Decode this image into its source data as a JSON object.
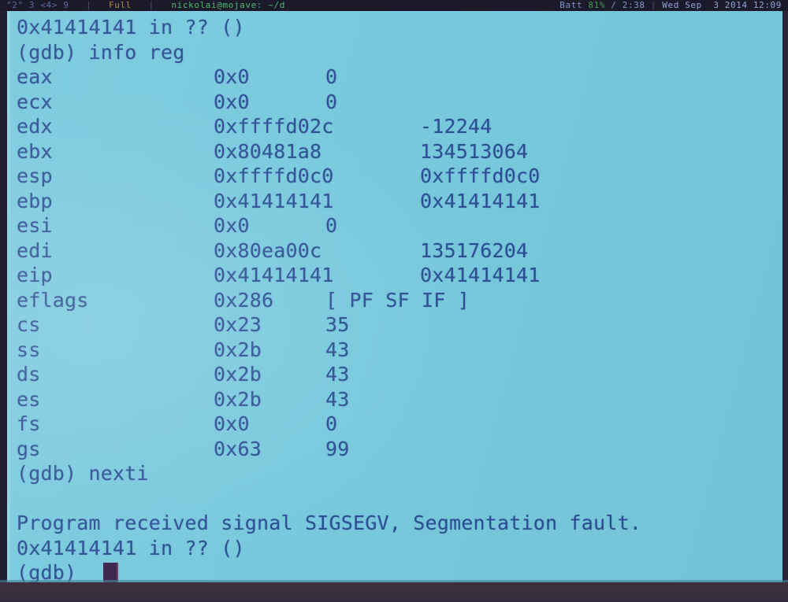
{
  "statusbar": {
    "workspaces": "°2° 3 <4> 9",
    "separator1": "|",
    "layout": "Full",
    "separator2": "|",
    "window_title": "nickolai@mojave: ~/d",
    "battery_label": "Batt",
    "battery_percent": "81%",
    "battery_divider": "/",
    "battery_time": "2:38",
    "separator3": "|",
    "datetime": "Wed Sep  3 2014 12:09"
  },
  "colors": {
    "terminal_bg": "#79c9dc",
    "terminal_fg": "#2e4f93",
    "statusbar_bg": "#1b1a2b",
    "cursor": "#3a2248",
    "frame": "#231f2e"
  },
  "terminal": {
    "prompt": "(gdb)",
    "lines": [
      {
        "type": "text",
        "text": "0x41414141 in ?? ()"
      },
      {
        "type": "text",
        "text": "(gdb) info reg"
      },
      {
        "type": "reg",
        "name": "eax",
        "hex": "0x0",
        "dec": "0",
        "wide": false
      },
      {
        "type": "reg",
        "name": "ecx",
        "hex": "0x0",
        "dec": "0",
        "wide": false
      },
      {
        "type": "reg",
        "name": "edx",
        "hex": "0xffffd02c",
        "dec": "-12244",
        "wide": true
      },
      {
        "type": "reg",
        "name": "ebx",
        "hex": "0x80481a8",
        "dec": "134513064",
        "wide": true
      },
      {
        "type": "reg",
        "name": "esp",
        "hex": "0xffffd0c0",
        "dec": "0xffffd0c0",
        "wide": true
      },
      {
        "type": "reg",
        "name": "ebp",
        "hex": "0x41414141",
        "dec": "0x41414141",
        "wide": true
      },
      {
        "type": "reg",
        "name": "esi",
        "hex": "0x0",
        "dec": "0",
        "wide": false
      },
      {
        "type": "reg",
        "name": "edi",
        "hex": "0x80ea00c",
        "dec": "135176204",
        "wide": true
      },
      {
        "type": "reg",
        "name": "eip",
        "hex": "0x41414141",
        "dec": "0x41414141",
        "wide": true
      },
      {
        "type": "reg",
        "name": "eflags",
        "hex": "0x286",
        "dec": "[ PF SF IF ]",
        "wide": false,
        "flags": true
      },
      {
        "type": "reg",
        "name": "cs",
        "hex": "0x23",
        "dec": "35",
        "wide": false
      },
      {
        "type": "reg",
        "name": "ss",
        "hex": "0x2b",
        "dec": "43",
        "wide": false
      },
      {
        "type": "reg",
        "name": "ds",
        "hex": "0x2b",
        "dec": "43",
        "wide": false
      },
      {
        "type": "reg",
        "name": "es",
        "hex": "0x2b",
        "dec": "43",
        "wide": false
      },
      {
        "type": "reg",
        "name": "fs",
        "hex": "0x0",
        "dec": "0",
        "wide": false
      },
      {
        "type": "reg",
        "name": "gs",
        "hex": "0x63",
        "dec": "99",
        "wide": false
      },
      {
        "type": "text",
        "text": "(gdb) nexti"
      },
      {
        "type": "text",
        "text": ""
      },
      {
        "type": "text",
        "text": "Program received signal SIGSEGV, Segmentation fault."
      },
      {
        "type": "text",
        "text": "0x41414141 in ?? ()"
      },
      {
        "type": "prompt",
        "text": "(gdb) "
      }
    ]
  }
}
